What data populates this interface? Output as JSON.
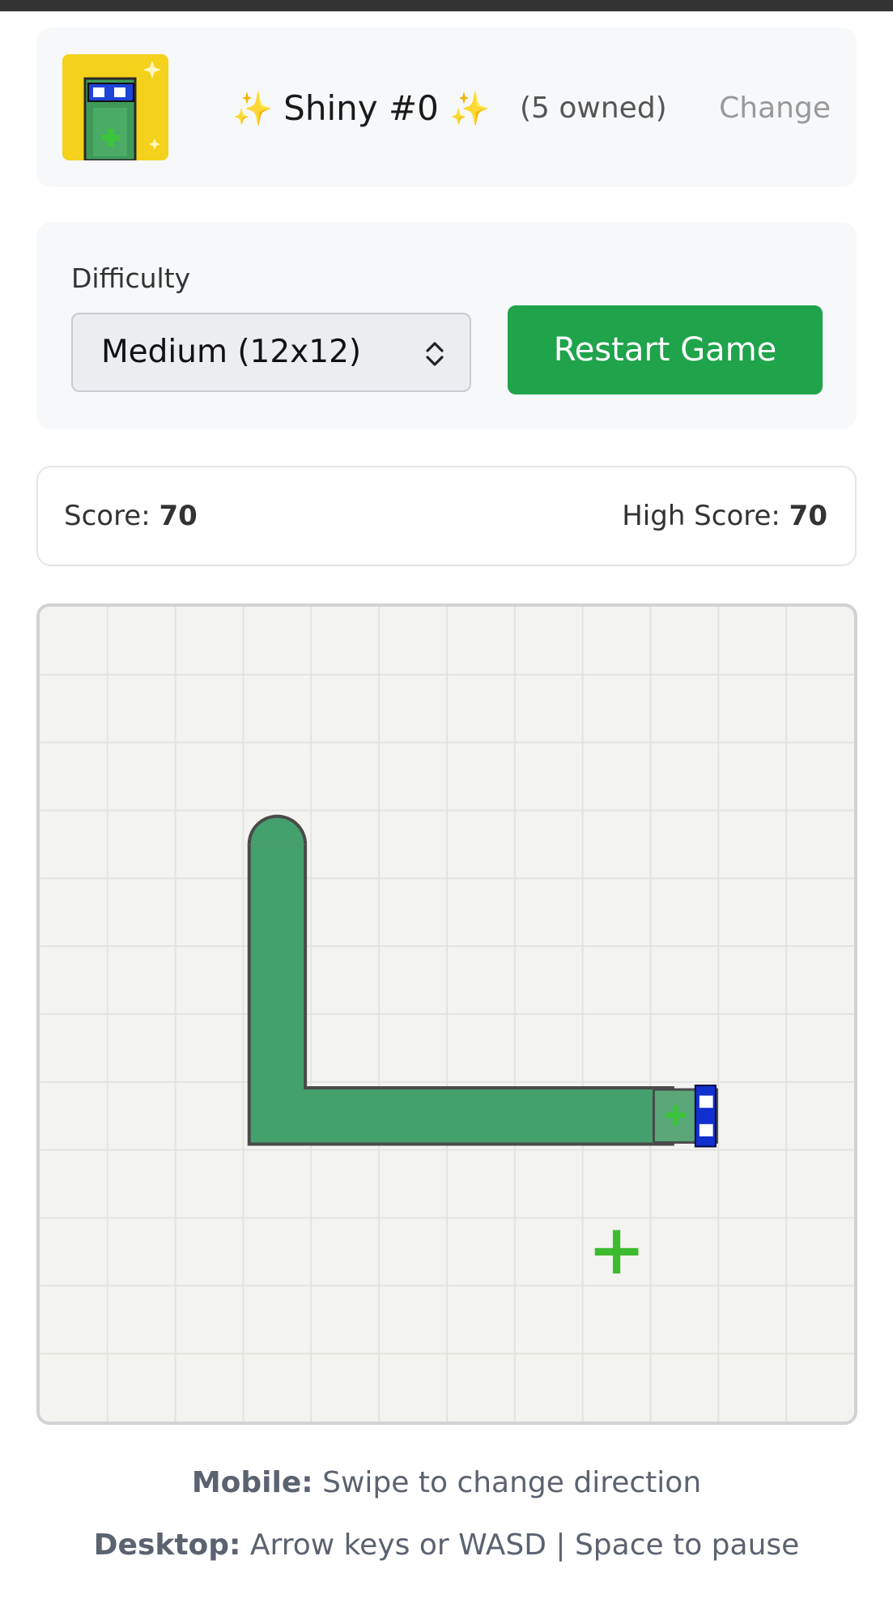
{
  "character": {
    "sparkle_left": "✨",
    "name": "Shiny #0",
    "sparkle_right": "✨",
    "owned": "(5 owned)",
    "change_label": "Change"
  },
  "settings": {
    "difficulty_label": "Difficulty",
    "difficulty_value": "Medium (12x12)",
    "restart_label": "Restart Game"
  },
  "scores": {
    "score_label": "Score:",
    "score_value": "70",
    "high_score_label": "High Score:",
    "high_score_value": "70"
  },
  "game": {
    "grid_size": 12,
    "direction": "right",
    "snake_path": [
      [
        3,
        3
      ],
      [
        3,
        4
      ],
      [
        3,
        5
      ],
      [
        3,
        6
      ],
      [
        3,
        7
      ],
      [
        4,
        7
      ],
      [
        5,
        7
      ],
      [
        6,
        7
      ],
      [
        7,
        7
      ],
      [
        8,
        7
      ],
      [
        9,
        7
      ]
    ],
    "food": [
      8,
      9
    ],
    "colors": {
      "board": "#f3f3f0",
      "grid": "#e3e3df",
      "snake_body": "#44a06d",
      "snake_outline": "#4a4a4a",
      "head_accessory": "#1030d0",
      "food": "#3dbb2e"
    }
  },
  "help": {
    "mobile_label": "Mobile:",
    "mobile_text": " Swipe to change direction",
    "desktop_label": "Desktop:",
    "desktop_text": " Arrow keys or WASD | Space to pause"
  }
}
